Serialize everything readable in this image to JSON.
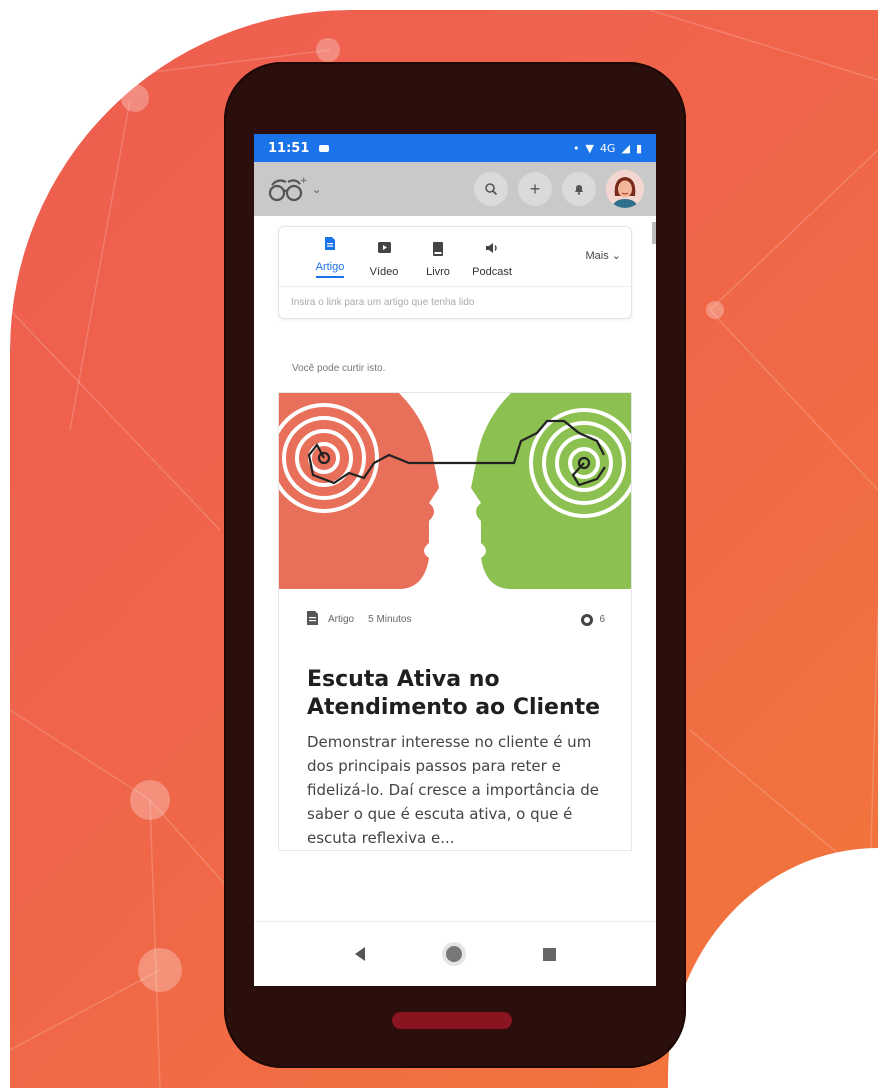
{
  "statusbar": {
    "time": "11:51",
    "signal_text": "4G"
  },
  "appbar": {
    "icons": [
      "glasses-logo-icon",
      "chevron-down-icon",
      "search-icon",
      "plus-icon",
      "bell-icon",
      "avatar"
    ]
  },
  "content_types": {
    "items": [
      {
        "label": "Artigo",
        "icon": "document-icon",
        "active": true
      },
      {
        "label": "Vídeo",
        "icon": "video-icon",
        "active": false
      },
      {
        "label": "Livro",
        "icon": "book-icon",
        "active": false
      },
      {
        "label": "Podcast",
        "icon": "podcast-icon",
        "active": false
      }
    ],
    "more_label": "Mais",
    "link_placeholder": "Insira o link para um artigo que tenha lido"
  },
  "suggestion_heading": "Você pode curtir isto.",
  "article": {
    "type_label": "Artigo",
    "duration": "5 Minutos",
    "comments": "6",
    "title": "Escuta Ativa no Atendimento ao Cliente",
    "description": "Demonstrar interesse no cliente é um dos principais passos para reter e fidelizá-lo. Daí cresce a importância de saber o que é escuta ativa, o que é escuta reflexiva e..."
  },
  "colors": {
    "accent": "#1a73e8",
    "background_gradient_start": "#ee5d50",
    "background_gradient_end": "#f2773a",
    "phone_body": "#2b0f0c",
    "hero_left": "#e8705a",
    "hero_right": "#8cc152"
  }
}
